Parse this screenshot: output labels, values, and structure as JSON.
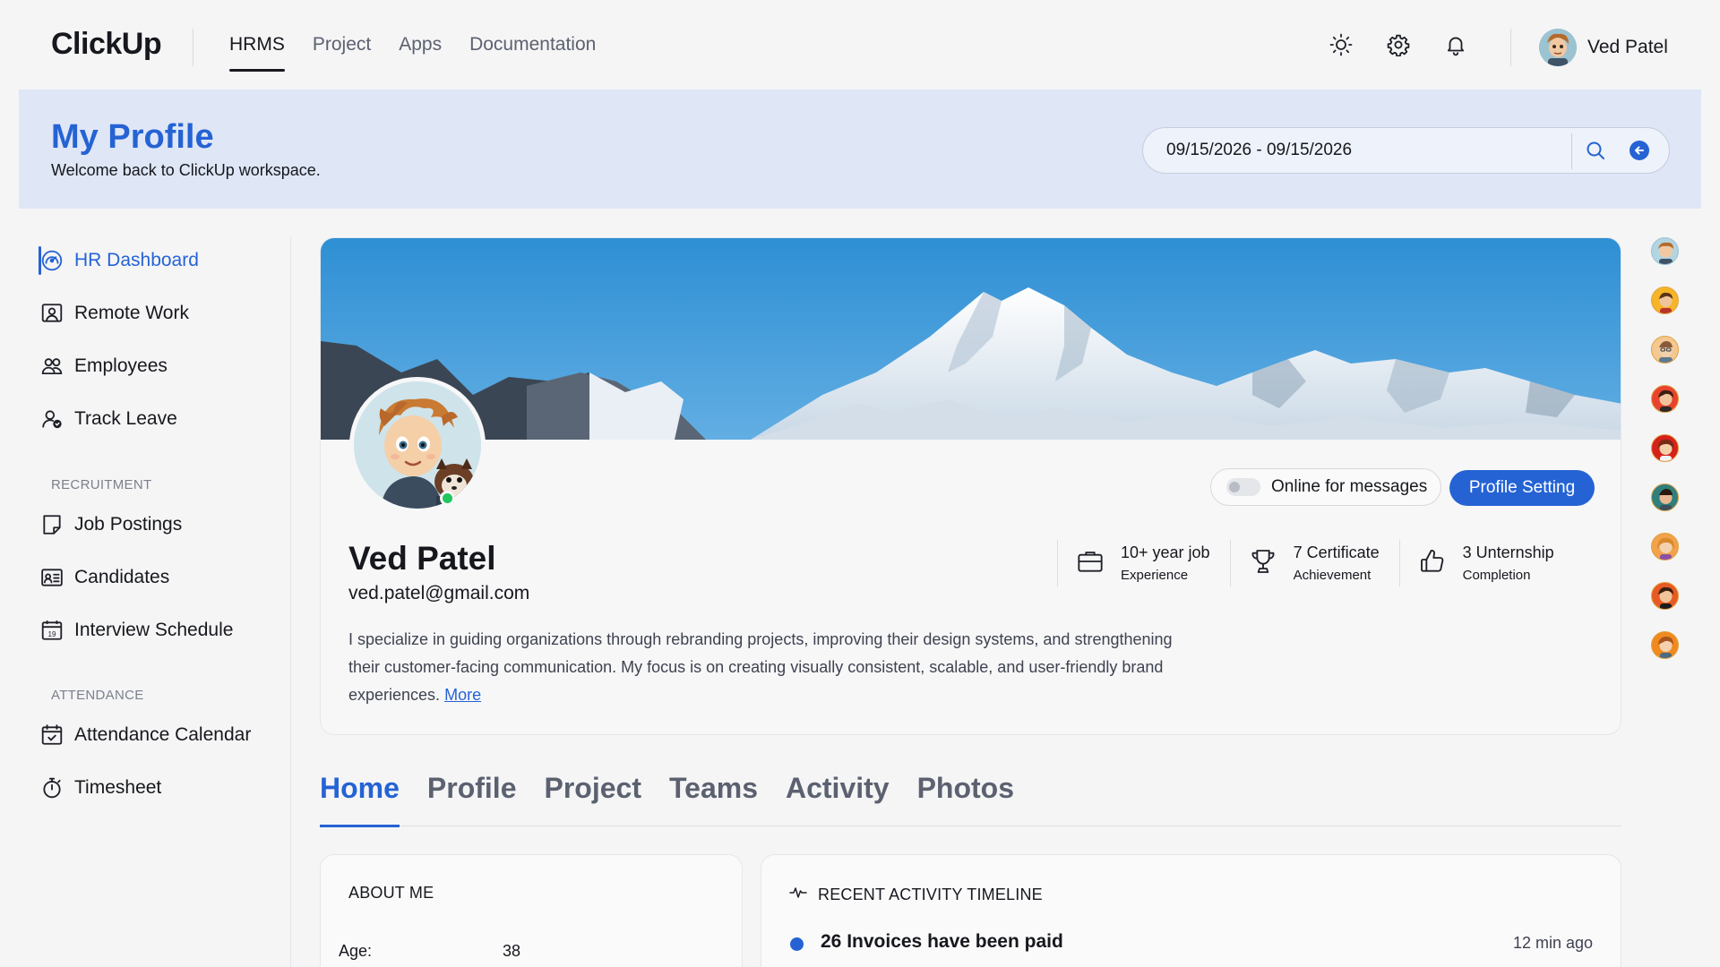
{
  "app": {
    "logo": "ClickUp",
    "nav": [
      "HRMS",
      "Project",
      "Apps",
      "Documentation"
    ],
    "active_nav": "HRMS",
    "user_name": "Ved Patel",
    "icons": [
      "sun-icon",
      "gear-icon",
      "bell-icon"
    ]
  },
  "header": {
    "title": "My Profile",
    "subtitle": "Welcome back to ClickUp workspace.",
    "date_range": "09/15/2026 - 09/15/2026"
  },
  "sidebar": {
    "items": [
      {
        "label": "HR Dashboard",
        "icon": "dashboard-icon",
        "active": true
      },
      {
        "label": "Remote Work",
        "icon": "remote-user-icon"
      },
      {
        "label": "Employees",
        "icon": "users-icon"
      },
      {
        "label": "Track Leave",
        "icon": "user-check-icon"
      }
    ],
    "sections": [
      {
        "title": "RECRUITMENT",
        "items": [
          {
            "label": "Job Postings",
            "icon": "document-icon"
          },
          {
            "label": "Candidates",
            "icon": "id-card-icon"
          },
          {
            "label": "Interview Schedule",
            "icon": "calendar-day-icon",
            "badge": "19"
          }
        ]
      },
      {
        "title": "ATTENDANCE",
        "items": [
          {
            "label": "Attendance Calendar",
            "icon": "calendar-check-icon"
          },
          {
            "label": "Timesheet",
            "icon": "stopwatch-icon"
          }
        ]
      }
    ]
  },
  "profile": {
    "name": "Ved Patel",
    "email": "ved.patel@gmail.com",
    "online_label": "Online for messages",
    "online": false,
    "setting_button": "Profile Setting",
    "stats": [
      {
        "top": "10+ year job",
        "bottom": "Experience",
        "icon": "briefcase-icon"
      },
      {
        "top": "7 Certificate",
        "bottom": "Achievement",
        "icon": "trophy-icon"
      },
      {
        "top": "3 Unternship",
        "bottom": "Completion",
        "icon": "thumbs-up-icon"
      }
    ],
    "bio": "I specialize in guiding organizations through rebranding projects, improving their design systems, and strengthening their customer-facing communication. My focus is on creating visually consistent, scalable, and user-friendly brand experiences.",
    "more_link": "More"
  },
  "tabs": [
    "Home",
    "Profile",
    "Project",
    "Teams",
    "Activity",
    "Photos"
  ],
  "active_tab": "Home",
  "about": {
    "title": "ABOUT ME",
    "age_label": "Age:",
    "age_value": "38"
  },
  "activity": {
    "title": "RECENT ACTIVITY TIMELINE",
    "items": [
      {
        "text": "26 Invoices have been paid",
        "time": "12 min ago"
      }
    ]
  },
  "colors": {
    "accent": "#2563d4",
    "header_band": "#dfe6f6",
    "online": "#22c55e"
  }
}
